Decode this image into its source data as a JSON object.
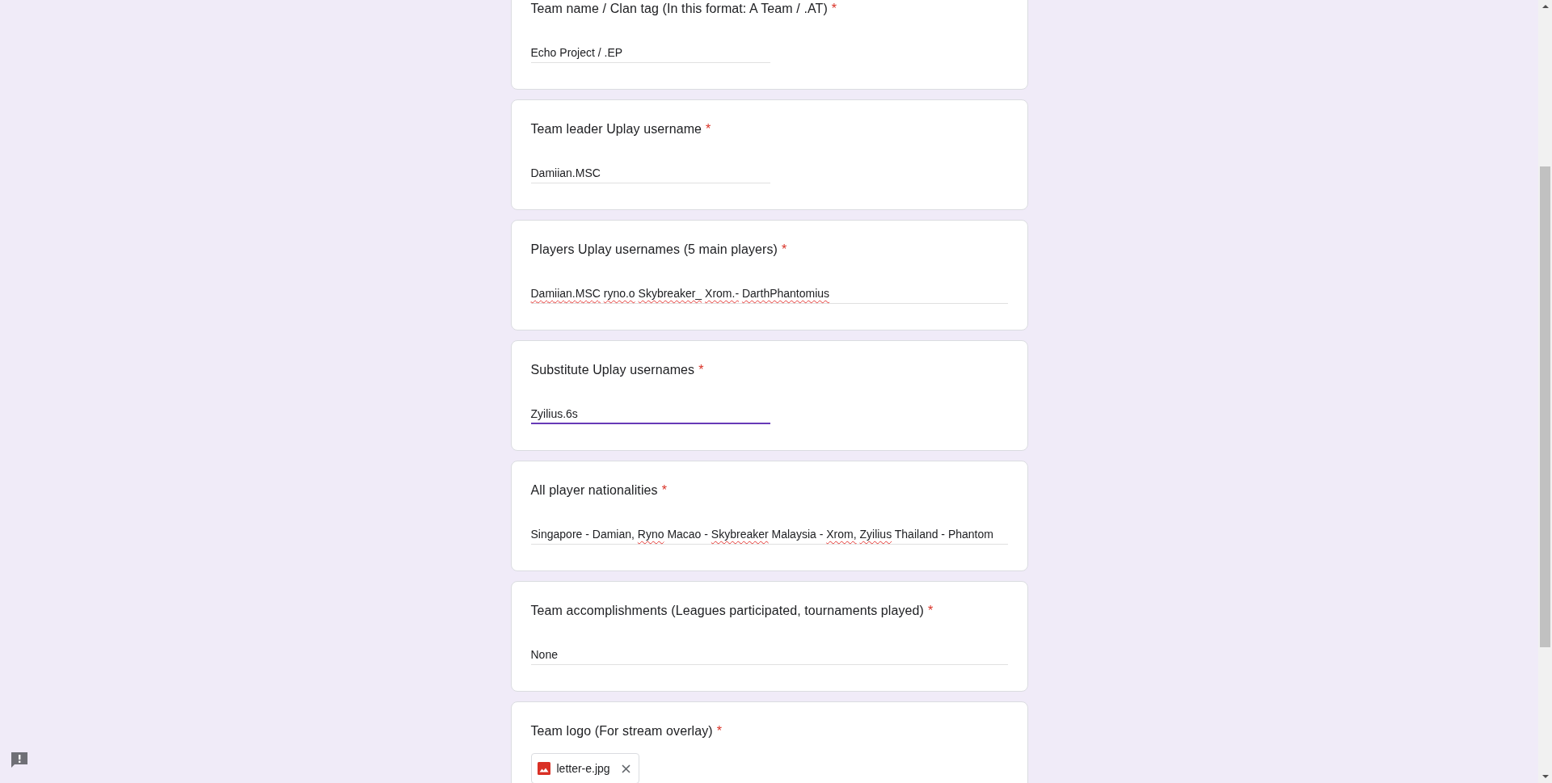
{
  "questions": [
    {
      "kind": "short",
      "title": "Team name / Clan tag (In this format: A Team / .AT)",
      "required_mark": "*",
      "focused": false,
      "answer_parts": [
        {
          "text": "Echo Project / .EP",
          "misspelled": false
        }
      ]
    },
    {
      "kind": "short",
      "title": "Team leader Uplay username",
      "required_mark": "*",
      "focused": false,
      "answer_parts": [
        {
          "text": "Damiian.MSC",
          "misspelled": false
        }
      ]
    },
    {
      "kind": "paragraph",
      "title": "Players Uplay usernames (5 main players)",
      "required_mark": "*",
      "focused": false,
      "answer_parts": [
        {
          "text": "Damiian.MSC ",
          "misspelled": true
        },
        {
          "text": "ryno.o ",
          "misspelled": true
        },
        {
          "text": "Skybreaker_ ",
          "misspelled": true
        },
        {
          "text": "Xrom.- ",
          "misspelled": true
        },
        {
          "text": "DarthPhantomius",
          "misspelled": true
        }
      ]
    },
    {
      "kind": "short",
      "title": "Substitute Uplay usernames",
      "required_mark": "*",
      "focused": true,
      "answer_parts": [
        {
          "text": "Zyilius.6s",
          "misspelled": false
        }
      ]
    },
    {
      "kind": "paragraph",
      "title": "All player nationalities",
      "required_mark": "*",
      "focused": false,
      "answer_parts": [
        {
          "text": "Singapore - Damian, ",
          "misspelled": false
        },
        {
          "text": "Ryno",
          "misspelled": true
        },
        {
          "text": " Macao - ",
          "misspelled": false
        },
        {
          "text": "Skybreaker",
          "misspelled": true
        },
        {
          "text": " Malaysia - ",
          "misspelled": false
        },
        {
          "text": "Xrom, ",
          "misspelled": true
        },
        {
          "text": "Zyilius",
          "misspelled": true
        },
        {
          "text": " Thailand - Phantom",
          "misspelled": false
        }
      ]
    },
    {
      "kind": "paragraph",
      "title": "Team accomplishments (Leagues participated, tournaments played)",
      "required_mark": "*",
      "focused": false,
      "answer_parts": [
        {
          "text": "None",
          "misspelled": false
        }
      ]
    },
    {
      "kind": "file",
      "title": "Team logo (For stream overlay)",
      "required_mark": "*",
      "files": [
        {
          "name": "letter-e.jpg"
        }
      ]
    }
  ]
}
